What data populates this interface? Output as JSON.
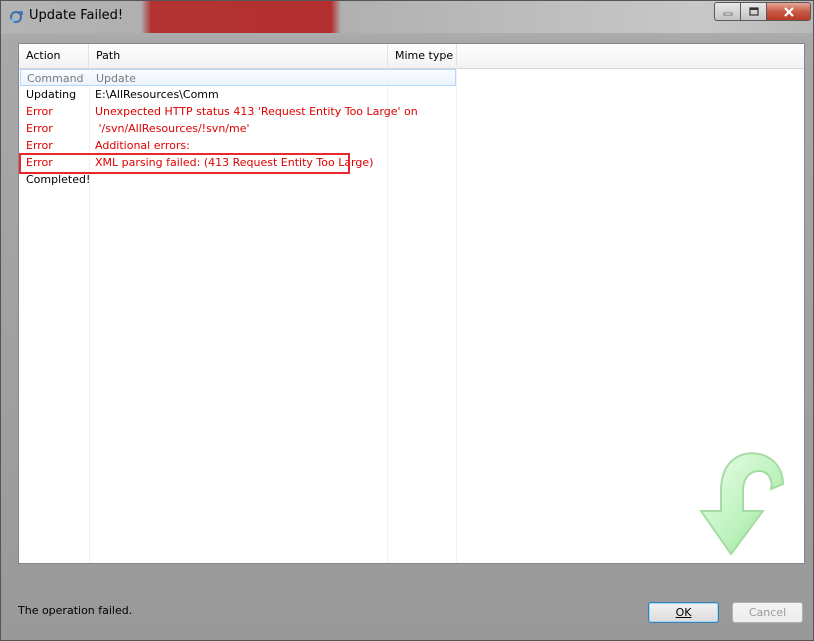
{
  "window": {
    "title": "Update Failed!",
    "icon": "svn-update-icon"
  },
  "columns": {
    "action": "Action",
    "path": "Path",
    "mime": "Mime type"
  },
  "rows": [
    {
      "action": "Command",
      "path": "Update",
      "style": "gray"
    },
    {
      "action": "Updating",
      "path": "E:\\AllResources\\Comm",
      "style": "black"
    },
    {
      "action": "Error",
      "path": "Unexpected HTTP status 413 'Request Entity Too Large' on",
      "style": "red"
    },
    {
      "action": "Error",
      "path": " '/svn/AllResources/!svn/me'",
      "style": "red"
    },
    {
      "action": "Error",
      "path": "Additional errors:",
      "style": "red"
    },
    {
      "action": "Error",
      "path": "XML parsing failed: (413 Request Entity Too Large)",
      "style": "red"
    },
    {
      "action": "Completed!",
      "path": "",
      "style": "black"
    }
  ],
  "status": "The operation failed.",
  "buttons": {
    "ok": "OK",
    "cancel": "Cancel"
  },
  "colors": {
    "error": "#e00000",
    "highlight": "#e8282a",
    "logo": "#7fe07f"
  }
}
